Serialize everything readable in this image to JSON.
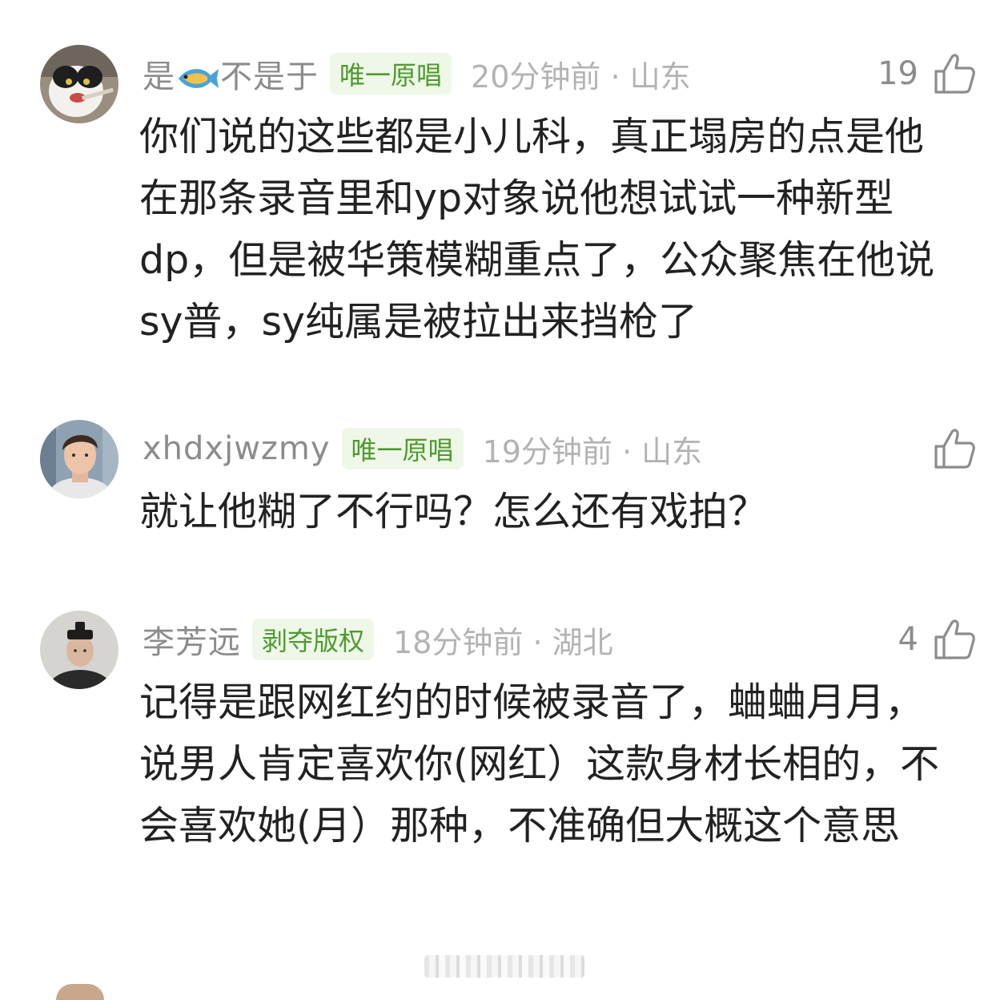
{
  "comments": [
    {
      "username_pre": "是",
      "username_post": "不是于",
      "username_icon": "fish-icon",
      "badge": "唯一原唱",
      "meta": "20分钟前 · 山东",
      "likes": "19",
      "body": "你们说的这些都是小儿科，真正塌房的点是他在那条录音里和yp对象说他想试试一种新型dp，但是被华策模糊重点了，公众聚焦在他说sy普，sy纯属是被拉出来挡枪了"
    },
    {
      "username": "xhdxjwzmy",
      "badge": "唯一原唱",
      "meta": "19分钟前 · 山东",
      "likes": "",
      "body": "就让他糊了不行吗？怎么还有戏拍？"
    },
    {
      "username": "李芳远",
      "badge": "剥夺版权",
      "meta": "18分钟前 · 湖北",
      "likes": "4",
      "body": "记得是跟网红约的时候被录音了，蛐蛐月月，说男人肯定喜欢你(网红）这款身材长相的，不会喜欢她(月）那种，不准确但大概这个意思"
    }
  ],
  "colors": {
    "badge_bg": "#eef7e8",
    "badge_text": "#4f9a2e",
    "meta": "#b3b3b3",
    "body_text": "#222222"
  }
}
